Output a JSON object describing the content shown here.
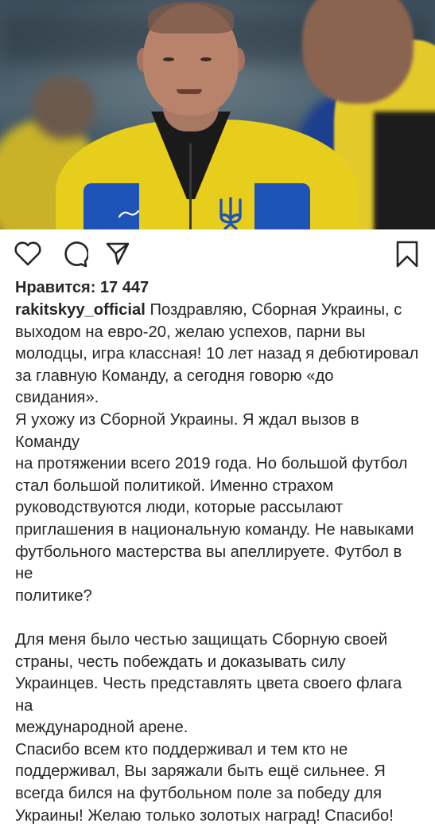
{
  "post": {
    "image_alt": "photo",
    "likes_label": "Нравится: 17 447",
    "username": "rakitskyy_official",
    "caption_lines": [
      "Поздравляю, Сборная Украины, с",
      "выходом на евро-20, желаю успехов, парни вы",
      "молодцы, игра классная! 10 лет назад я дебютировал",
      "за главную Команду, а сегодня говорю «до свидания».",
      "Я ухожу из Сборной Украины. Я ждал вызов в Команду",
      "на протяжении всего 2019 года. Но большой футбол",
      "стал большой политикой. Именно страхом",
      "руководствуются люди, которые рассылают",
      "приглашения в национальную команду. Не навыками",
      "футбольного мастерства вы апеллируете.  Футбол в не",
      "политике?"
    ],
    "caption_lines_2": [
      "Для меня было честью защищать Сборную своей",
      "страны, честь побеждать и доказывать силу",
      "Украинцев. Честь представлять цвета своего флага на",
      "международной арене.",
      "Спасибо всем кто поддерживал и тем кто не",
      "поддерживал, Вы заряжали быть ещё сильнее. Я",
      "всегда бился на футбольном поле за победу для",
      "Украины! Желаю только золотых наград! Спасибо!"
    ]
  },
  "actions": {
    "like_icon": "heart-icon",
    "comment_icon": "comment-icon",
    "share_icon": "paper-plane-icon",
    "save_icon": "bookmark-icon"
  },
  "colors": {
    "text": "#262626",
    "background": "#ffffff",
    "jersey_yellow": "#e7cd1c",
    "jersey_blue": "#1e53b8"
  }
}
